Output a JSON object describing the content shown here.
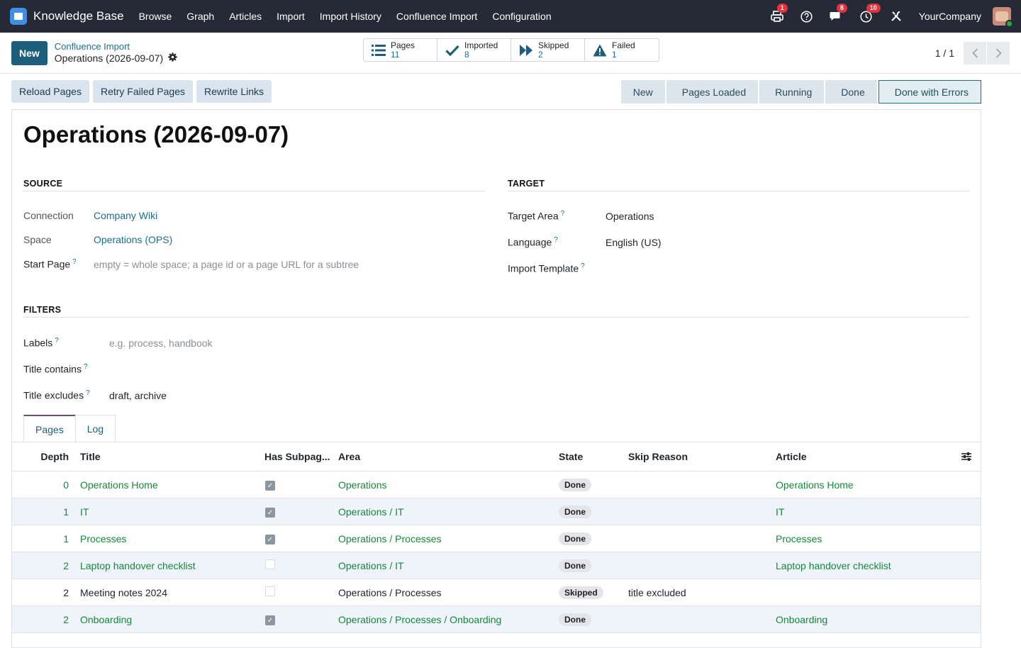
{
  "nav": {
    "app_name": "Knowledge Base",
    "items": [
      "Browse",
      "Graph",
      "Articles",
      "Import",
      "Import History",
      "Confluence Import",
      "Configuration"
    ],
    "printer_badge": "1",
    "chat_badge": "8",
    "activity_badge": "10",
    "company": "YourCompany"
  },
  "control": {
    "new_label": "New",
    "breadcrumb_parent": "Confluence Import",
    "breadcrumb_current": "Operations (2026-09-07)",
    "stats": [
      {
        "label": "Pages",
        "value": "11",
        "icon": "list-icon"
      },
      {
        "label": "Imported",
        "value": "8",
        "icon": "check-icon"
      },
      {
        "label": "Skipped",
        "value": "2",
        "icon": "fast-forward-icon"
      },
      {
        "label": "Failed",
        "value": "1",
        "icon": "warning-icon"
      }
    ],
    "pager_text": "1 / 1"
  },
  "actions": {
    "reload": "Reload Pages",
    "retry": "Retry Failed Pages",
    "rewrite": "Rewrite Links"
  },
  "stages": [
    "New",
    "Pages Loaded",
    "Running",
    "Done",
    "Done with Errors"
  ],
  "record": {
    "title": "Operations (2026-09-07)",
    "source_head": "SOURCE",
    "target_head": "TARGET",
    "filters_head": "FILTERS",
    "connection_label": "Connection",
    "connection_value": "Company Wiki",
    "space_label": "Space",
    "space_value": "Operations (OPS)",
    "start_page_label": "Start Page",
    "start_page_placeholder": "empty = whole space; a page id or a page URL for a subtree",
    "target_area_label": "Target Area",
    "target_area_value": "Operations",
    "language_label": "Language",
    "language_value": "English (US)",
    "template_label": "Import Template",
    "labels_label": "Labels",
    "labels_placeholder": "e.g. process, handbook",
    "title_contains_label": "Title contains",
    "title_excludes_label": "Title excludes",
    "title_excludes_value": "draft, archive",
    "help_mark": "?"
  },
  "tabs": [
    "Pages",
    "Log"
  ],
  "table": {
    "headers": {
      "depth": "Depth",
      "title": "Title",
      "sub": "Has Subpag...",
      "area": "Area",
      "state": "State",
      "skip": "Skip Reason",
      "article": "Article"
    },
    "rows": [
      {
        "depth": "0",
        "title": "Operations Home",
        "has_sub": true,
        "area": "Operations",
        "state": "Done",
        "skip": "",
        "article": "Operations Home",
        "green": true
      },
      {
        "depth": "1",
        "title": "IT",
        "has_sub": true,
        "area": "Operations / IT",
        "state": "Done",
        "skip": "",
        "article": "IT",
        "green": true
      },
      {
        "depth": "1",
        "title": "Processes",
        "has_sub": true,
        "area": "Operations / Processes",
        "state": "Done",
        "skip": "",
        "article": "Processes",
        "green": true
      },
      {
        "depth": "2",
        "title": "Laptop handover checklist",
        "has_sub": false,
        "area": "Operations / IT",
        "state": "Done",
        "skip": "",
        "article": "Laptop handover checklist",
        "green": true
      },
      {
        "depth": "2",
        "title": "Meeting notes 2024",
        "has_sub": false,
        "area": "Operations / Processes",
        "state": "Skipped",
        "skip": "title excluded",
        "article": "",
        "green": false
      },
      {
        "depth": "2",
        "title": "Onboarding",
        "has_sub": true,
        "area": "Operations / Processes / Onboarding",
        "state": "Done",
        "skip": "",
        "article": "Onboarding",
        "green": true
      }
    ]
  }
}
